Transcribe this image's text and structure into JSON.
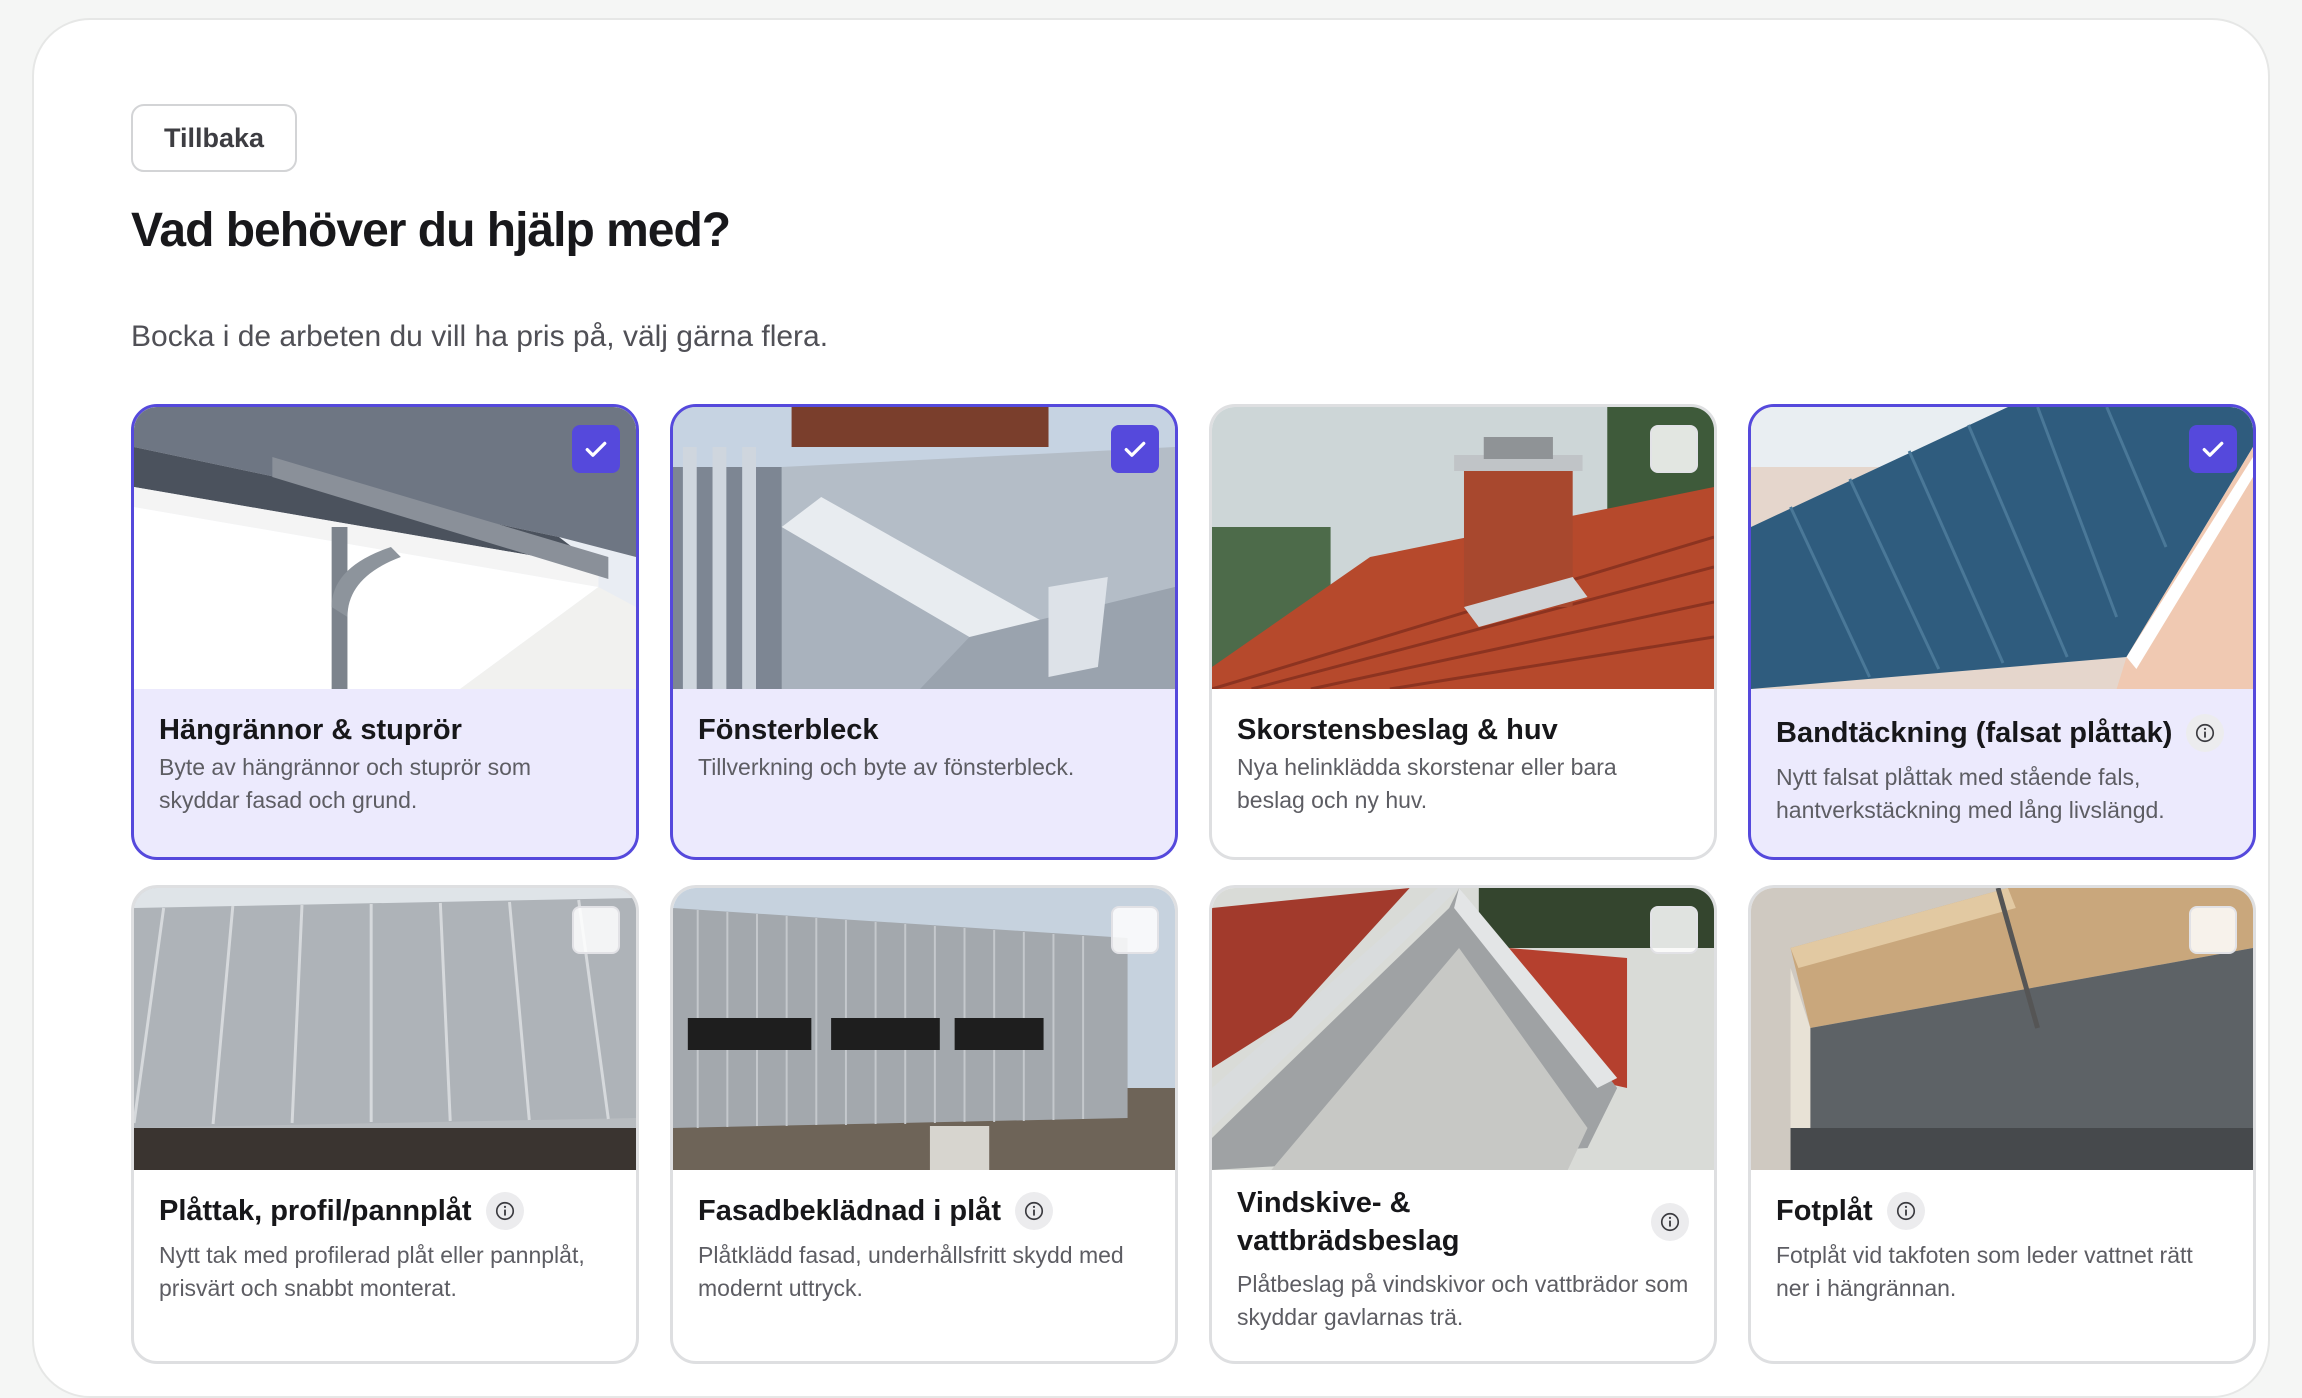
{
  "nav": {
    "back_label": "Tillbaka"
  },
  "page": {
    "title": "Vad behöver du hjälp med?",
    "subtitle": "Bocka i de arbeten du vill ha pris på, välj gärna flera."
  },
  "colors": {
    "accent": "#5549dc",
    "selected_bg": "#eceafd",
    "border": "#dedfe1"
  },
  "services": [
    {
      "title": "Hängrännor & stuprör",
      "description": "Byte av hängrännor och stuprör som skyddar fasad och grund.",
      "selected": true,
      "has_info": false,
      "image": "gutter-downpipe-photo"
    },
    {
      "title": "Fönsterbleck",
      "description": "Tillverkning och byte av fönsterbleck.",
      "selected": true,
      "has_info": false,
      "image": "window-sill-flashing-photo"
    },
    {
      "title": "Skorstensbeslag & huv",
      "description": "Nya helinklädda skorstenar eller bara beslag och ny huv.",
      "selected": false,
      "has_info": false,
      "image": "chimney-tile-roof-photo"
    },
    {
      "title": "Bandtäckning (falsat plåttak)",
      "description": "Nytt falsat plåttak med stående fals, hantverkstäckning med lång livslängd.",
      "selected": true,
      "has_info": true,
      "image": "standing-seam-roof-photo"
    },
    {
      "title": "Plåttak, profil/pannplåt",
      "description": "Nytt tak med profilerad plåt eller pannplåt, prisvärt och snabbt monterat.",
      "selected": false,
      "has_info": true,
      "image": "profiled-metal-roof-photo"
    },
    {
      "title": "Fasadbeklädnad i plåt",
      "description": "Plåtklädd fasad, underhållsfritt skydd med modernt uttryck.",
      "selected": false,
      "has_info": true,
      "image": "metal-facade-photo"
    },
    {
      "title": "Vindskive- & vattbrädsbeslag",
      "description": "Plåtbeslag på vindskivor och vattbrädor som skyddar gavlarnas trä.",
      "selected": false,
      "has_info": true,
      "image": "gable-flashing-photo"
    },
    {
      "title": "Fotplåt",
      "description": "Fotplåt vid takfoten som leder vattnet rätt ner i hängrännan.",
      "selected": false,
      "has_info": true,
      "image": "eave-flashing-photo"
    }
  ]
}
